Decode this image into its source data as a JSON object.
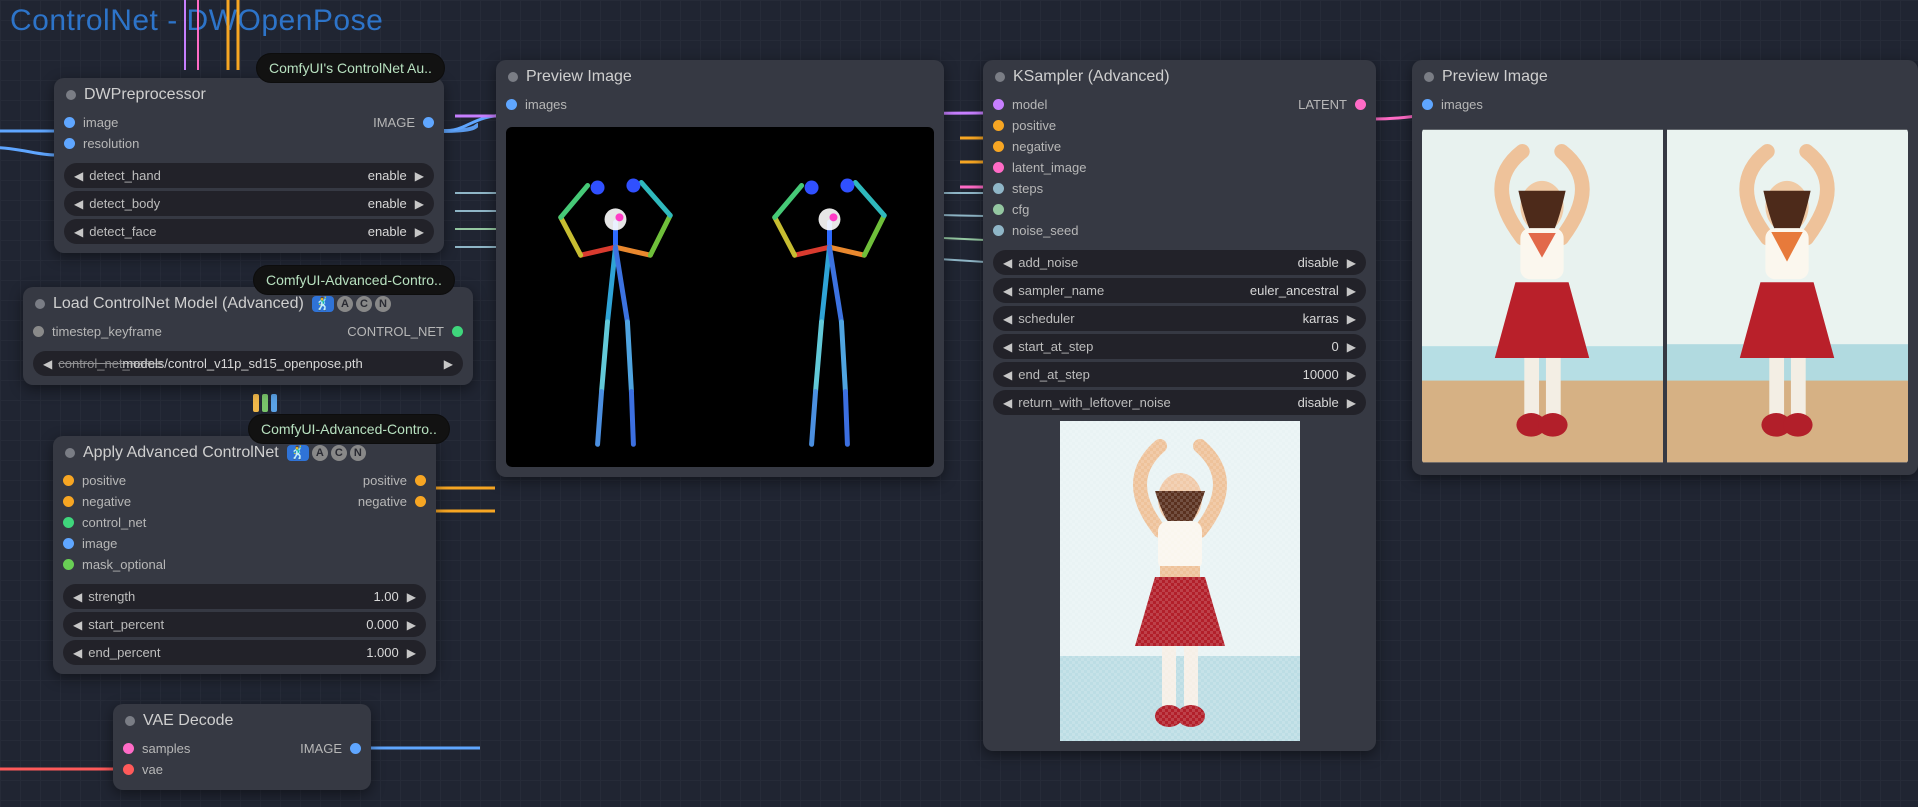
{
  "group": {
    "title": "ControlNet - DWOpenPose"
  },
  "tags": {
    "controlnet_aux": "ComfyUI's ControlNet Au..",
    "advanced_controlnet_a": "ComfyUI-Advanced-Contro..",
    "advanced_controlnet_b": "ComfyUI-Advanced-Contro.."
  },
  "nodes": {
    "dwpre": {
      "title": "DWPreprocessor",
      "inputs": {
        "image": "image",
        "resolution": "resolution"
      },
      "outputs": {
        "image_out": "IMAGE"
      },
      "widgets": [
        {
          "name": "detect_hand",
          "value": "enable"
        },
        {
          "name": "detect_body",
          "value": "enable"
        },
        {
          "name": "detect_face",
          "value": "enable"
        }
      ]
    },
    "loadcn": {
      "title": "Load ControlNet Model (Advanced)",
      "inputs": {
        "timestep_keyframe": "timestep_keyframe"
      },
      "outputs": {
        "control_net_out": "CONTROL_NET"
      },
      "widget": {
        "name": "control_net_name",
        "value": "models/control_v11p_sd15_openpose.pth"
      }
    },
    "applycn": {
      "title": "Apply Advanced ControlNet",
      "inputs": {
        "positive": "positive",
        "negative": "negative",
        "control_net": "control_net",
        "image": "image",
        "mask_optional": "mask_optional"
      },
      "outputs": {
        "positive": "positive",
        "negative": "negative"
      },
      "widgets": [
        {
          "name": "strength",
          "value": "1.00"
        },
        {
          "name": "start_percent",
          "value": "0.000"
        },
        {
          "name": "end_percent",
          "value": "1.000"
        }
      ]
    },
    "vaedecode": {
      "title": "VAE Decode",
      "inputs": {
        "samples": "samples",
        "vae": "vae"
      },
      "outputs": {
        "image_out": "IMAGE"
      }
    },
    "preview1": {
      "title": "Preview Image",
      "inputs": {
        "images": "images"
      }
    },
    "preview2": {
      "title": "Preview Image",
      "inputs": {
        "images": "images"
      }
    },
    "ksampler": {
      "title": "KSampler (Advanced)",
      "inputs": {
        "model": "model",
        "positive": "positive",
        "negative": "negative",
        "latent_image": "latent_image",
        "steps": "steps",
        "cfg": "cfg",
        "noise_seed": "noise_seed"
      },
      "outputs": {
        "latent_out": "LATENT"
      },
      "widgets": [
        {
          "name": "add_noise",
          "value": "disable"
        },
        {
          "name": "sampler_name",
          "value": "euler_ancestral"
        },
        {
          "name": "scheduler",
          "value": "karras"
        },
        {
          "name": "start_at_step",
          "value": "0"
        },
        {
          "name": "end_at_step",
          "value": "10000"
        },
        {
          "name": "return_with_leftover_noise",
          "value": "disable"
        }
      ]
    }
  },
  "acn_badge": {
    "sq": "🕺",
    "a": "A",
    "c": "C",
    "n": "N"
  },
  "colors": {
    "image": "#5fa6ff",
    "control_net": "#3fd67c",
    "positive": "#f7a623",
    "negative": "#f7a623",
    "mask": "#69cf55",
    "model": "#c77fff",
    "latent": "#ff6bc6",
    "vae": "#ff5a5a",
    "int": "#8fb6c7",
    "float": "#94c7a1"
  }
}
